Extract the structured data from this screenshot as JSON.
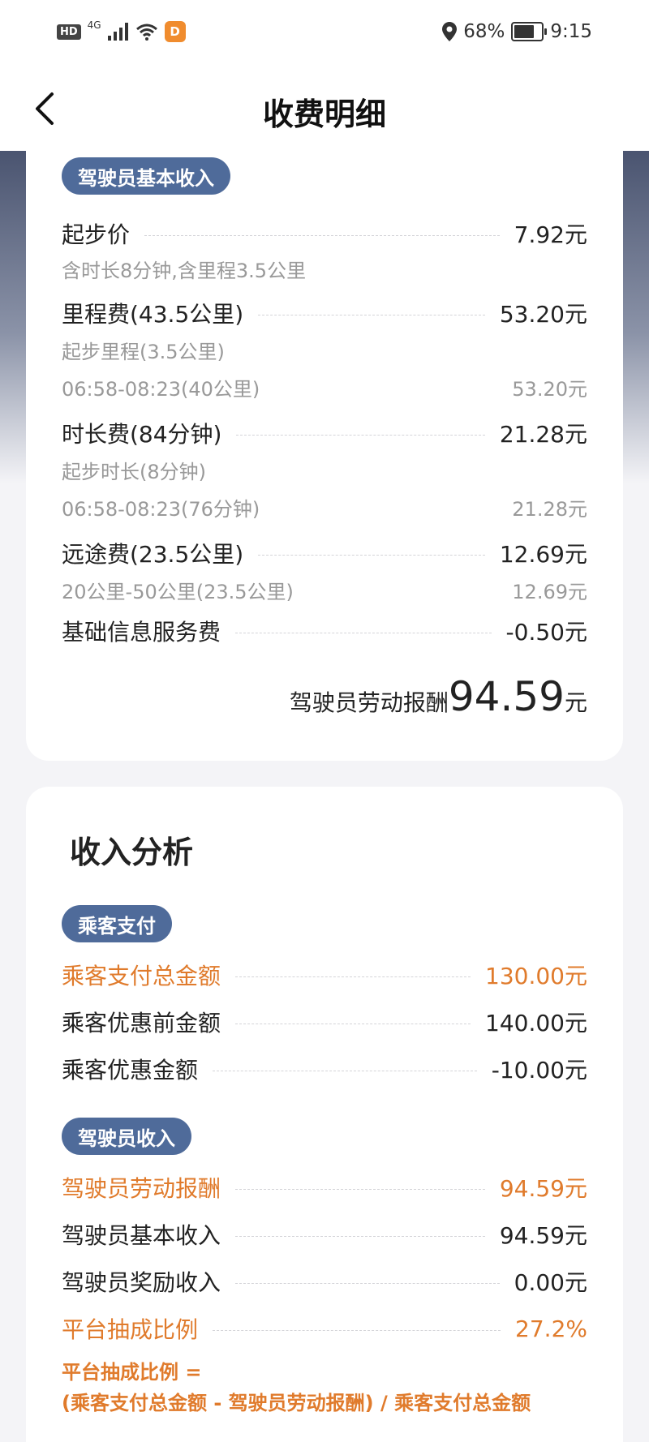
{
  "status_bar": {
    "hd": "HD",
    "network": "4G",
    "battery_percent": "68%",
    "time": "9:15",
    "app_glyph": "D"
  },
  "header": {
    "title": "收费明细",
    "back_icon": "chevron-left-icon"
  },
  "basic_income": {
    "badge": "驾驶员基本收入",
    "start_fee": {
      "label": "起步价",
      "value": "7.92元",
      "note": "含时长8分钟,含里程3.5公里"
    },
    "mileage_fee": {
      "label": "里程费(43.5公里)",
      "value": "53.20元",
      "sub1_label": "起步里程(3.5公里)",
      "sub2_label": "06:58-08:23(40公里)",
      "sub2_value": "53.20元"
    },
    "time_fee": {
      "label": "时长费(84分钟)",
      "value": "21.28元",
      "sub1_label": "起步时长(8分钟)",
      "sub2_label": "06:58-08:23(76分钟)",
      "sub2_value": "21.28元"
    },
    "long_distance_fee": {
      "label": "远途费(23.5公里)",
      "value": "12.69元",
      "sub_label": "20公里-50公里(23.5公里)",
      "sub_value": "12.69元"
    },
    "info_service_fee": {
      "label": "基础信息服务费",
      "value": "-0.50元"
    },
    "total": {
      "label": "驾驶员劳动报酬",
      "amount": "94.59",
      "unit": "元"
    }
  },
  "income_analysis": {
    "title": "收入分析",
    "passenger_badge": "乘客支付",
    "passenger_total": {
      "label": "乘客支付总金额",
      "value": "130.00元"
    },
    "pre_discount": {
      "label": "乘客优惠前金额",
      "value": "140.00元"
    },
    "discount": {
      "label": "乘客优惠金额",
      "value": "-10.00元"
    },
    "driver_badge": "驾驶员收入",
    "driver_pay": {
      "label": "驾驶员劳动报酬",
      "value": "94.59元"
    },
    "driver_basic": {
      "label": "驾驶员基本收入",
      "value": "94.59元"
    },
    "driver_bonus": {
      "label": "驾驶员奖励收入",
      "value": "0.00元"
    },
    "commission": {
      "label": "平台抽成比例",
      "value": "27.2%"
    },
    "formula_line1": "平台抽成比例 =",
    "formula_line2": "(乘客支付总金额 - 驾驶员劳动报酬) / 乘客支付总金额"
  },
  "colors": {
    "accent_orange": "#e07b2c",
    "badge_blue": "#4f6b9a"
  }
}
